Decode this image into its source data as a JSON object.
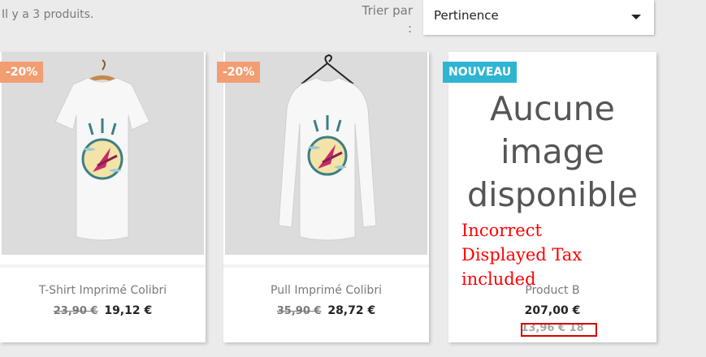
{
  "listing": {
    "count_text": "Il y a 3 produits.",
    "sort_label": "Trier par",
    "sort_colon": ":",
    "sort_value": "Pertinence"
  },
  "products": [
    {
      "badge": "-20%",
      "name": "T-Shirt Imprimé Colibri",
      "old_price": "23,90 €",
      "price": "19,12 €"
    },
    {
      "badge": "-20%",
      "name": "Pull Imprimé Colibri",
      "old_price": "35,90 €",
      "price": "28,72 €"
    },
    {
      "badge": "NOUVEAU",
      "no_image_lines": [
        "Aucune",
        "image",
        "disponible"
      ],
      "annotation": [
        "Incorrect",
        "Displayed Tax included"
      ],
      "name": "Product B",
      "price": "207,00 €",
      "tax_text": "13,96 € 18"
    }
  ],
  "colors": {
    "discount_badge": "#f39d72",
    "new_badge": "#2fb5d2",
    "annotation": "#ff0000"
  }
}
